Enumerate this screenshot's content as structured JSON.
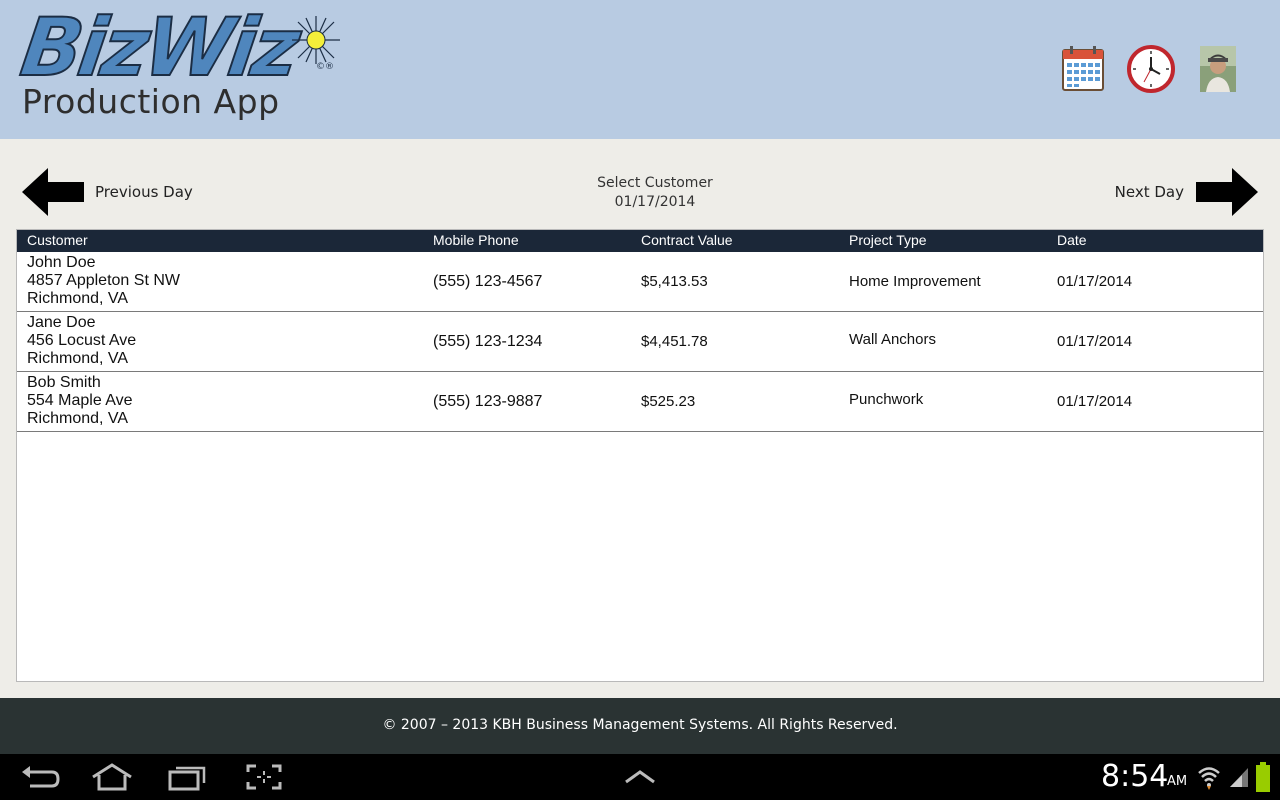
{
  "header": {
    "logo_title": "BizWiz",
    "logo_reg": "©®",
    "logo_subtitle": "Production App"
  },
  "nav": {
    "prev_label": "Previous Day",
    "next_label": "Next Day",
    "center_title": "Select Customer",
    "center_date": "01/17/2014"
  },
  "table": {
    "columns": [
      "Customer",
      "Mobile Phone",
      "Contract Value",
      "Project Type",
      "Date"
    ],
    "rows": [
      {
        "name": "John Doe",
        "address": "4857 Appleton St NW",
        "city": "Richmond, VA",
        "phone": "(555) 123-4567",
        "value": "$5,413.53",
        "project_type": "Home Improvement",
        "date": "01/17/2014"
      },
      {
        "name": "Jane Doe",
        "address": "456 Locust Ave",
        "city": "Richmond, VA",
        "phone": "(555) 123-1234",
        "value": "$4,451.78",
        "project_type": "Wall Anchors",
        "date": "01/17/2014"
      },
      {
        "name": "Bob Smith",
        "address": "554 Maple Ave",
        "city": "Richmond, VA",
        "phone": "(555) 123-9887",
        "value": "$525.23",
        "project_type": "Punchwork",
        "date": "01/17/2014"
      }
    ]
  },
  "footer": {
    "copyright": "© 2007 – 2013 KBH Business Management Systems. All Rights Reserved."
  },
  "status": {
    "time": "8:54",
    "ampm": "AM"
  },
  "colors": {
    "header_bg": "#b8cbe2",
    "table_header_bg": "#1b2738",
    "footer_bg": "#2a3333",
    "logo_blue": "#4f86bd"
  }
}
